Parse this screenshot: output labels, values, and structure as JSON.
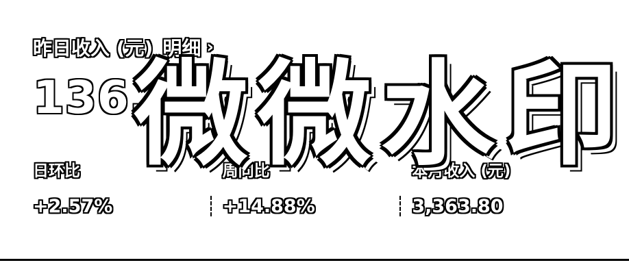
{
  "header": {
    "title": "昨日收入 (元)",
    "detail_label": "明细",
    "detail_chevron": "›"
  },
  "summary": {
    "amount": "136."
  },
  "stats": [
    {
      "label": "日环比",
      "value": "+2.57%"
    },
    {
      "label": "周同比",
      "value": "+14.88%"
    },
    {
      "label": "本月收入 (元)",
      "value": "3,363.80"
    }
  ],
  "watermark": {
    "text": "微微水印"
  },
  "icons": {
    "detail": "chevron-right-icon"
  }
}
